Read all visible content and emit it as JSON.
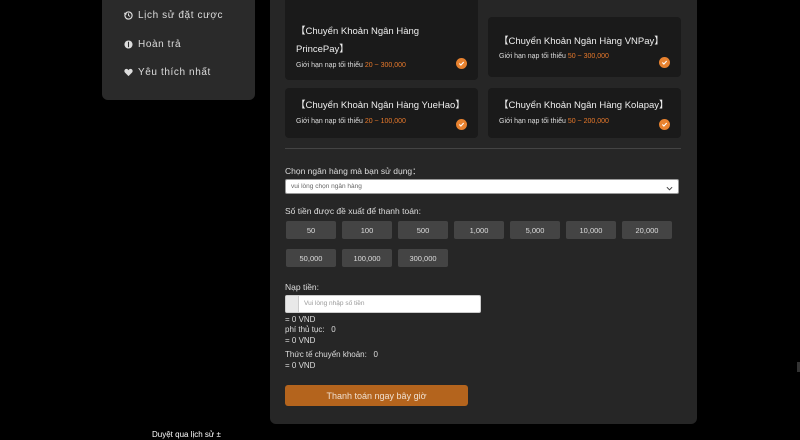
{
  "sidebar": {
    "items": [
      {
        "label": "Lịch sử đặt cược",
        "icon": "history-icon"
      },
      {
        "label": "Hoàn trả",
        "icon": "refund-icon"
      },
      {
        "label": "Yêu thích nhất",
        "icon": "heart-icon"
      }
    ]
  },
  "history_link": "Duyệt qua lịch sử ±",
  "cards": [
    {
      "title_line1": "【Chuyển Khoản Ngân Hàng",
      "title_line2": "PrincePay】",
      "limit_prefix": "Giới hạn nạp tối thiểu",
      "limit_range": "20 ~ 300,000"
    },
    {
      "title_line1": "【Chuyển Khoản Ngân Hàng VNPay】",
      "limit_prefix": "Giới hạn nạp tối thiểu",
      "limit_range": "50 ~ 300,000"
    },
    {
      "title_line1": "【Chuyển Khoản Ngân Hàng YueHao】",
      "limit_prefix": "Giới hạn nạp tối thiểu",
      "limit_range": "20 ~ 100,000"
    },
    {
      "title_line1": "【Chuyển Khoản Ngân Hàng Kolapay】",
      "limit_prefix": "Giới hạn nạp tối thiểu",
      "limit_range": "50 ~ 200,000"
    }
  ],
  "bank_select": {
    "label": "Chọn ngân hàng mà bạn sử dụng：",
    "placeholder": "vui lòng chọn ngân hàng"
  },
  "suggested": {
    "label": "Số tiền được đề xuất để thanh toán:",
    "amounts": [
      "50",
      "100",
      "500",
      "1,000",
      "5,000",
      "10,000",
      "20,000",
      "50,000",
      "100,000",
      "300,000"
    ]
  },
  "deposit": {
    "label": "Nạp tiền:",
    "placeholder": "Vui lòng nhập số tiền",
    "converted": "= 0 VND",
    "fee_label": "phí thủ tục:",
    "fee_value": "0",
    "fee_converted": "= 0 VND",
    "actual_label": "Thức tế chuyển khoản:",
    "actual_value": "0",
    "actual_converted": "= 0 VND"
  },
  "pay_button": "Thanh toán ngay bây giờ",
  "colors": {
    "accent": "#e8792b",
    "button": "#b4641d",
    "panel": "#262626",
    "card": "#1a1a1a"
  }
}
